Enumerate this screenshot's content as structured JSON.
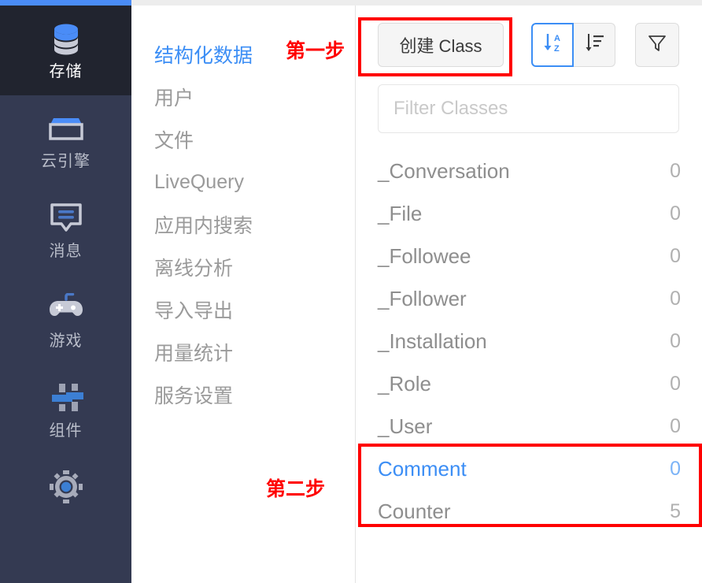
{
  "theme": {
    "accent_blue": "#3c8ef5",
    "rail_bg": "#343a52",
    "rail_active_bg": "#21242f",
    "annotation_red": "#ff0000"
  },
  "rail": {
    "items": [
      {
        "label": "存储",
        "icon": "database-icon",
        "active": true
      },
      {
        "label": "云引擎",
        "icon": "cloud-engine-icon",
        "active": false
      },
      {
        "label": "消息",
        "icon": "message-bubble-icon",
        "active": false
      },
      {
        "label": "游戏",
        "icon": "gamepad-icon",
        "active": false
      },
      {
        "label": "组件",
        "icon": "sliders-icon",
        "active": false
      },
      {
        "label": "",
        "icon": "gear-icon",
        "active": false
      }
    ]
  },
  "menu": {
    "items": [
      {
        "label": "结构化数据",
        "active": true
      },
      {
        "label": "用户",
        "active": false
      },
      {
        "label": "文件",
        "active": false
      },
      {
        "label": "LiveQuery",
        "active": false
      },
      {
        "label": "应用内搜索",
        "active": false
      },
      {
        "label": "离线分析",
        "active": false
      },
      {
        "label": "导入导出",
        "active": false
      },
      {
        "label": "用量统计",
        "active": false
      },
      {
        "label": "服务设置",
        "active": false
      }
    ]
  },
  "annotations": {
    "step1": "第一步",
    "step2": "第二步"
  },
  "toolbar": {
    "create_class_label": "创建 Class",
    "sort_alpha_icon": "sort-alpha-asc-icon",
    "sort_list_icon": "sort-list-icon",
    "filter_icon": "funnel-icon"
  },
  "search": {
    "placeholder": "Filter Classes",
    "value": ""
  },
  "classes": [
    {
      "name": "_Conversation",
      "count": "0",
      "highlight": false
    },
    {
      "name": "_File",
      "count": "0",
      "highlight": false
    },
    {
      "name": "_Followee",
      "count": "0",
      "highlight": false
    },
    {
      "name": "_Follower",
      "count": "0",
      "highlight": false
    },
    {
      "name": "_Installation",
      "count": "0",
      "highlight": false
    },
    {
      "name": "_Role",
      "count": "0",
      "highlight": false
    },
    {
      "name": "_User",
      "count": "0",
      "highlight": false
    },
    {
      "name": "Comment",
      "count": "0",
      "highlight": true
    },
    {
      "name": "Counter",
      "count": "5",
      "highlight": false
    }
  ]
}
